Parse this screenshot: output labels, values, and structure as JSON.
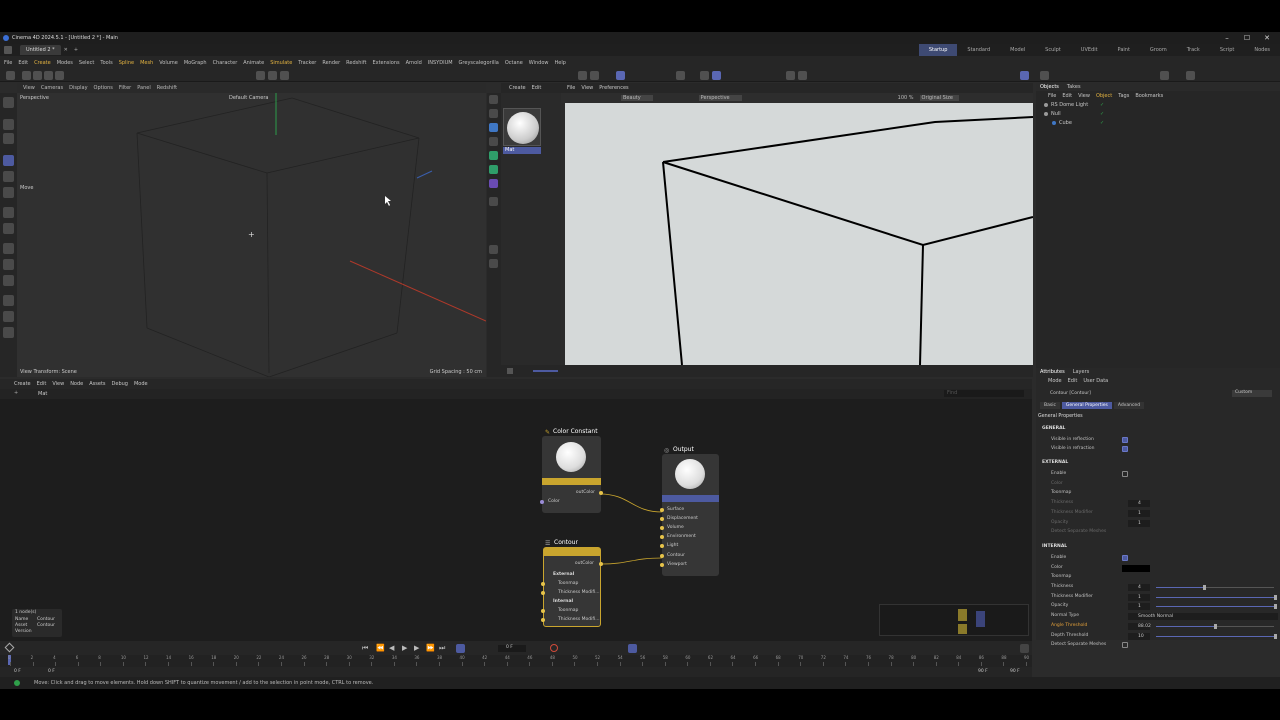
{
  "window": {
    "title": "Cinema 4D 2024.5.1 - [Untitled 2 *] - Main"
  },
  "doc_tab": "Untitled 2 *",
  "layouts": [
    "Startup",
    "Standard",
    "Model",
    "Sculpt",
    "UVEdit",
    "Paint",
    "Groom",
    "Track",
    "Script",
    "Nodes"
  ],
  "active_layout": "Startup",
  "menu": [
    "File",
    "Edit",
    "Create",
    "Modes",
    "Select",
    "Tools",
    "Spline",
    "Mesh",
    "Volume",
    "MoGraph",
    "Character",
    "Animate",
    "Simulate",
    "Tracker",
    "Render",
    "Redshift",
    "Extensions",
    "Arnold",
    "INSYDIUM",
    "Greyscalegorilla",
    "Octane",
    "Window",
    "Help"
  ],
  "viewport": {
    "menu": [
      "View",
      "Cameras",
      "Display",
      "Options",
      "Filter",
      "Panel",
      "Redshift"
    ],
    "label": "Perspective",
    "camera": "Default Camera",
    "move_label": "Move",
    "view_transform": "View Transform: Scene",
    "grid_spacing": "Grid Spacing : 50 cm"
  },
  "material_panel": {
    "menu": [
      "Create",
      "Edit"
    ],
    "material_name": "Mat"
  },
  "render_view": {
    "menu": [
      "File",
      "View",
      "Preferences"
    ],
    "aov": "Beauty",
    "camera": "Perspective",
    "zoom": "100 %",
    "size": "Original Size"
  },
  "object_manager": {
    "tabs": [
      "Objects",
      "Takes"
    ],
    "menu": [
      "File",
      "Edit",
      "View",
      "Object",
      "Tags",
      "Bookmarks"
    ],
    "items": [
      {
        "name": "RS Dome Light",
        "indent": 0
      },
      {
        "name": "Null",
        "indent": 0
      },
      {
        "name": "Cube",
        "indent": 1
      }
    ]
  },
  "node_editor": {
    "menu": [
      "Create",
      "Edit",
      "View",
      "Node",
      "Assets",
      "Debug",
      "Mode"
    ],
    "breadcrumb": "Mat",
    "search_placeholder": "Find",
    "nodes": {
      "color_constant": {
        "title": "Color Constant",
        "out": "outColor",
        "in": "Color"
      },
      "output": {
        "title": "Output",
        "ports": [
          "Surface",
          "Displacement",
          "Volume",
          "Environment",
          "Light",
          "Contour",
          "Viewport"
        ]
      },
      "contour": {
        "title": "Contour",
        "out": "outColor",
        "groups": [
          {
            "name": "External",
            "ports": [
              "Toonmap",
              "Thickness Modifi..."
            ]
          },
          {
            "name": "Internal",
            "ports": [
              "Toonmap",
              "Thickness Modifi..."
            ]
          }
        ]
      }
    },
    "info": {
      "count": "1 node(s)",
      "name_label": "Name",
      "name_value": "Contour",
      "asset_label": "Asset",
      "asset_value": "Contour",
      "version_label": "Version"
    }
  },
  "attributes": {
    "tabs": [
      "Attributes",
      "Layers"
    ],
    "menu": [
      "Mode",
      "Edit",
      "User Data"
    ],
    "object": "Contour [Contour]",
    "preset": "Custom",
    "subtabs": [
      "Basic",
      "General Properties",
      "Advanced"
    ],
    "active_subtab": "General Properties",
    "section_title": "General Properties",
    "general": {
      "title": "GENERAL",
      "rows": [
        {
          "label": "Visible in reflection",
          "checked": true
        },
        {
          "label": "Visible in refraction",
          "checked": true
        }
      ]
    },
    "external": {
      "title": "EXTERNAL",
      "rows": [
        "Enable",
        "Color",
        "Toonmap",
        "Thickness",
        "Thickness Modifier",
        "Opacity",
        "Detect Separate Meshes"
      ],
      "thickness": "4",
      "thickness_modifier": "1",
      "opacity": "1"
    },
    "internal": {
      "title": "INTERNAL",
      "rows": [
        "Enable",
        "Color",
        "Toonmap",
        "Thickness",
        "Thickness Modifier",
        "Opacity",
        "Normal Type",
        "Angle Threshold",
        "Depth Threshold",
        "Detect Separate Meshes"
      ],
      "thickness": "4",
      "thickness_modifier": "1",
      "opacity": "1",
      "normal_type": "Smooth Normal",
      "angle_threshold": "88.02",
      "depth_threshold": "10",
      "color": "#000000",
      "thickness_level": 0.4,
      "angle_level": 0.49
    }
  },
  "timeline": {
    "frame": "0 F",
    "ticks": [
      "0",
      "2",
      "4",
      "6",
      "8",
      "10",
      "12",
      "14",
      "16",
      "18",
      "20",
      "22",
      "24",
      "26",
      "28",
      "30",
      "32",
      "34",
      "36",
      "38",
      "40",
      "42",
      "44",
      "46",
      "48",
      "50",
      "52",
      "54",
      "56",
      "58",
      "60",
      "62",
      "64",
      "66",
      "68",
      "70",
      "72",
      "74",
      "76",
      "78",
      "80",
      "82",
      "84",
      "86",
      "88",
      "90"
    ],
    "start": "0 F",
    "end": "90 F",
    "end2": "90 F"
  },
  "status": "Move: Click and drag to move elements. Hold down SHIFT to quantize movement / add to the selection in point mode, CTRL to remove.",
  "colors": {
    "accent": "#4d5aa0",
    "node_yellow": "#c9a52e",
    "node_blue": "#4d5aa0"
  }
}
